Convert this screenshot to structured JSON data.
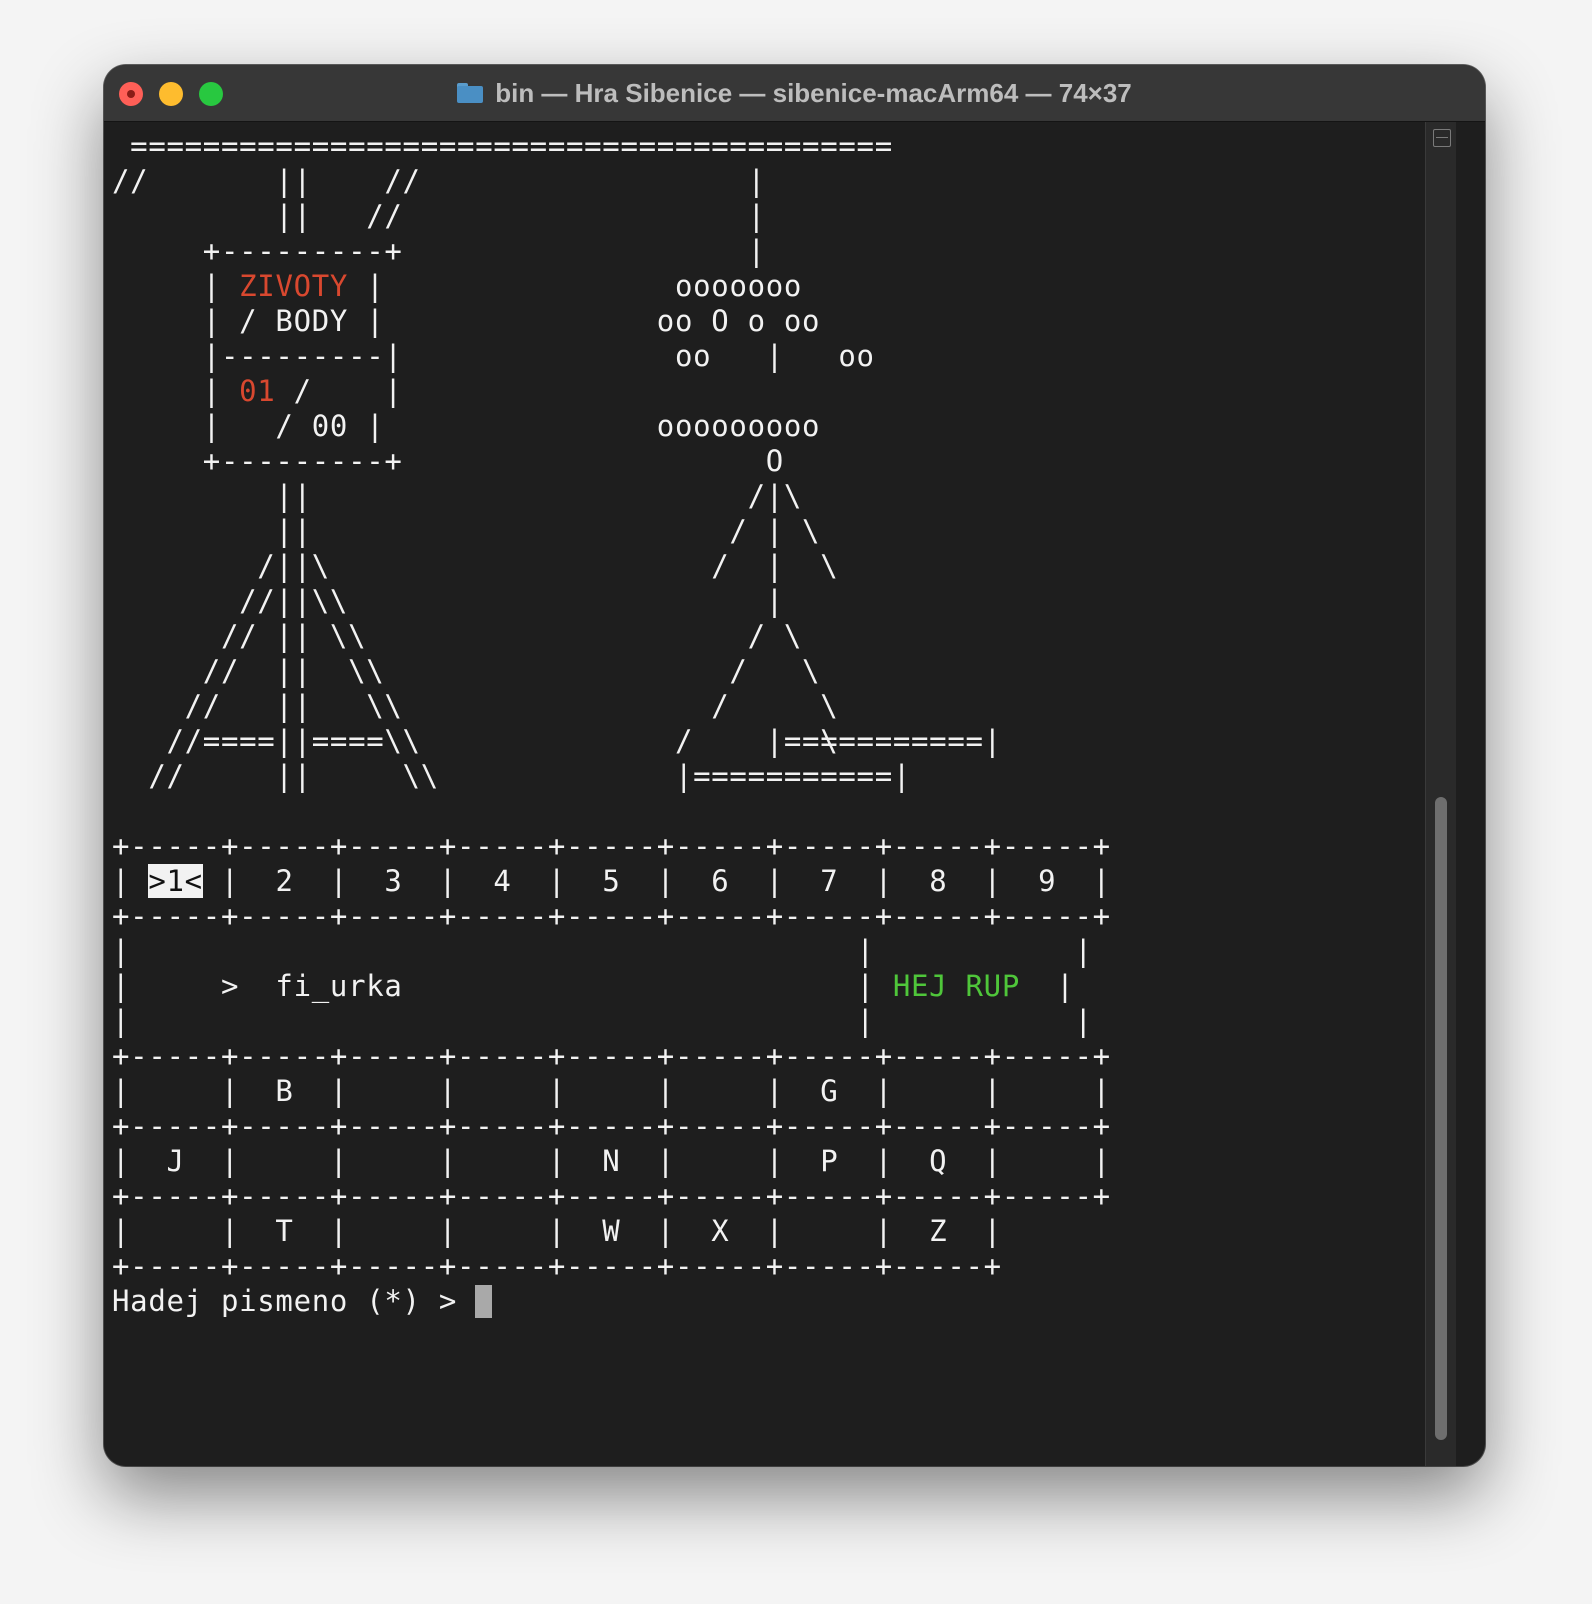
{
  "window": {
    "title": "bin — Hra Sibenice — sibenice-macArm64 — 74×37"
  },
  "terminal": {
    "lines": [
      " ==========================================",
      "//       ||    //                  |",
      "         ||   //                   |",
      "     +---------+                   |",
      "     | ",
      "     | / BODY |               oo O o oo",
      "     |---------|               oo   |   oo",
      "     | ",
      "     |   / 00 |               ooooooooo",
      "     +---------+                    O",
      "         ||                        /|\\",
      "         ||                       / | \\",
      "        /||\\                     /  |  \\",
      "       //||\\\\                       |",
      "      // || \\\\                     / \\",
      "     //  ||  \\\\                   /   \\",
      "    //   ||   \\\\                 /     \\",
      "   //====||====\\\\              /       \\",
      "  //     ||     \\\\             |===========|",
      "",
      "+-----+-----+-----+-----+-----+-----+-----+-----+-----+",
      "| ",
      "+-----+-----+-----+-----+-----+-----+-----+-----+-----+",
      "|                                        |           |",
      "|     >  fi_urka                         | ",
      "|                                        |           |",
      "+-----+-----+-----+-----+-----+-----+-----+-----+-----+",
      "|     |  B  |     |     |     |     |  G  |     |     |",
      "+-----+-----+-----+-----+-----+-----+-----+-----+-----+",
      "|  J  |     |     |     |  N  |     |  P  |  Q  |     |",
      "+-----+-----+-----+-----+-----+-----+-----+-----+-----+",
      "|     |  T  |     |     |  W  |  X  |     |  Z  |",
      "+-----+-----+-----+-----+-----+-----+-----+-----+",
      "Hadej pismeno (*) > "
    ],
    "spans": {
      "l4_zivoty": "ZIVOTY",
      "l4_tail": " |                ooooooo",
      "l7_lives": "01",
      "l7_tail": " /    |",
      "l7_noose_pad": "",
      "l21_sel": ">1<",
      "l21_tail": " |  2  |  3  |  4  |  5  |  6  |  7  |  8  |  9  |",
      "l24_msg": "HEJ RUP",
      "l24_tail": "  |",
      "platform_top": "                                    |===========|"
    }
  },
  "colors": {
    "background": "#1e1e1e",
    "text": "#f2f2f2",
    "lives": "#d9482f",
    "message": "#4fc63a",
    "titlebar": "#373737"
  },
  "icons": {
    "title": "folder-icon",
    "scroll": "split-pane-icon"
  }
}
